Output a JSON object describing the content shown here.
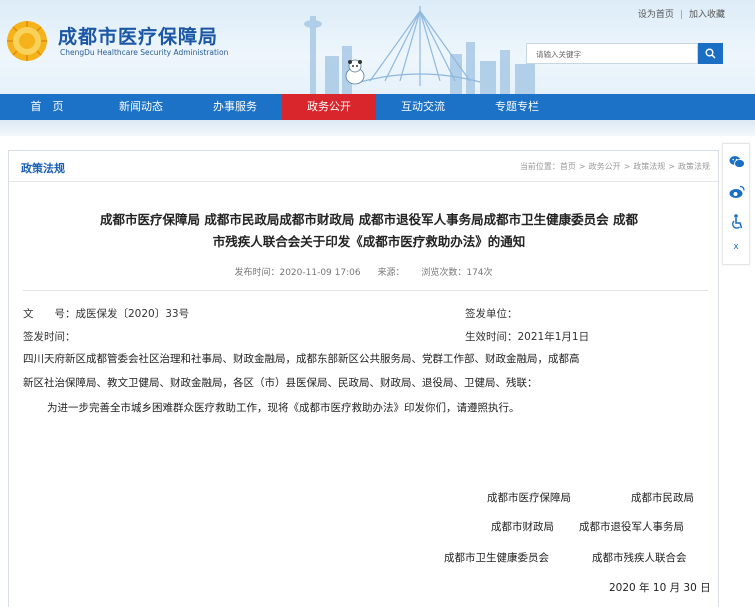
{
  "site": {
    "title": "成都市医疗保障局",
    "subtitle": "ChengDu Healthcare Security Administration",
    "top_links": [
      "设为首页",
      "加入收藏"
    ]
  },
  "search": {
    "placeholder": "请输入关键字"
  },
  "nav": {
    "items": [
      {
        "label": "首　页"
      },
      {
        "label": "新闻动态"
      },
      {
        "label": "办事服务"
      },
      {
        "label": "政务公开"
      },
      {
        "label": "互动交流"
      },
      {
        "label": "专题专栏"
      }
    ],
    "active_index": 3
  },
  "section": {
    "title": "政策法规",
    "breadcrumb": [
      "当前位置：",
      "首页",
      "政务公开",
      "政策法规",
      "政策法规"
    ]
  },
  "article": {
    "title_line1": "成都市医疗保障局 成都市民政局成都市财政局 成都市退役军人事务局成都市卫生健康委员会 成都",
    "title_line2": "市残疾人联合会关于印发《成都市医疗救助办法》的通知",
    "publish_time": "发布时间：2020-11-09 17:06",
    "source": "来源：",
    "views": "浏览次数：174次",
    "doc_no": "文　　号：成医保发〔2020〕33号",
    "issuer": "签发单位：",
    "sign_date": "签发时间：",
    "effective_date": "生效时间：2021年1月1日",
    "recipients_line1": "四川天府新区成都管委会社区治理和社事局、财政金融局，成都东部新区公共服务局、党群工作部、财政金融局，成都高",
    "recipients_line2": "新区社治保障局、教文卫健局、财政金融局，各区（市）县医保局、民政局、财政局、退役局、卫健局、残联：",
    "paragraph": "为进一步完善全市城乡困难群众医疗救助工作，现将《成都市医疗救助办法》印发你们，请遵照执行。",
    "signatures": [
      [
        "成都市医疗保障局",
        "成都市民政局"
      ],
      [
        "成都市财政局",
        "成都市退役军人事务局"
      ],
      [
        "成都市卫生健康委员会",
        "成都市残疾人联合会"
      ]
    ],
    "date": "2020 年 10 月 30 日"
  },
  "share": {
    "icons": [
      "wechat-icon",
      "weibo-icon",
      "accessibility-icon"
    ],
    "close_label": "x"
  },
  "colors": {
    "brand_blue": "#1c72c7",
    "active_red": "#d9262c",
    "title_blue": "#1b57a6",
    "section_blue": "#1a5fb4"
  }
}
